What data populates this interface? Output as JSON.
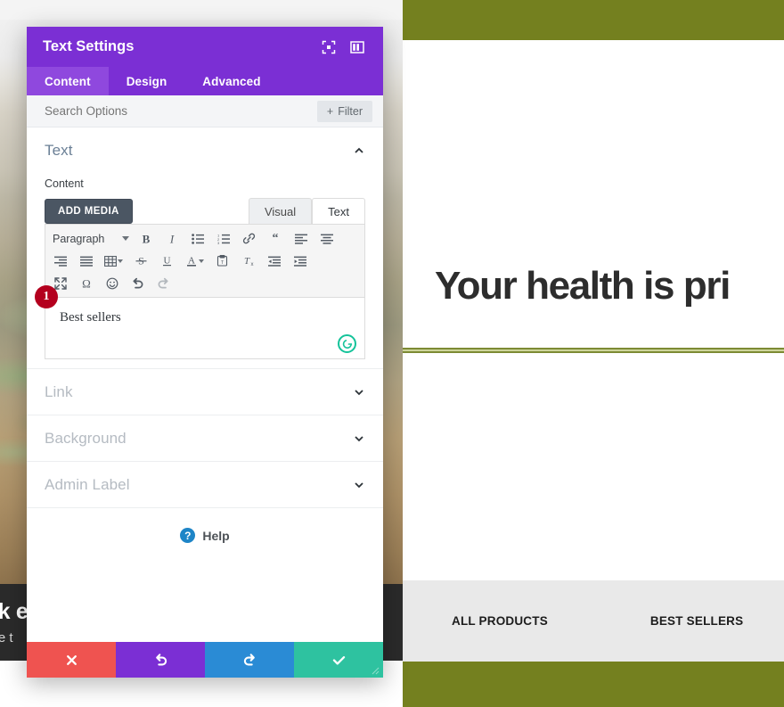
{
  "website": {
    "hero_heading": "Your health is pri",
    "dark_band": {
      "heading": "ck e",
      "subtext": "ove t"
    },
    "nav": [
      {
        "label": "ALL PRODUCTS"
      },
      {
        "label": "BEST SELLERS"
      }
    ],
    "colors": {
      "olive": "#74801f",
      "olive_rule": "#7d8b34",
      "dark": "#2b2b2b",
      "nav_strip": "#e9e9e9"
    }
  },
  "modal": {
    "title": "Text Settings",
    "header_icons": [
      {
        "name": "focus-mode-icon"
      },
      {
        "name": "layout-panel-icon"
      }
    ],
    "tabs": [
      {
        "label": "Content",
        "active": true
      },
      {
        "label": "Design",
        "active": false
      },
      {
        "label": "Advanced",
        "active": false
      }
    ],
    "search": {
      "placeholder": "Search Options",
      "value": ""
    },
    "filter_button": {
      "label": "Filter",
      "plus": "+"
    },
    "sections": [
      {
        "label": "Text",
        "expanded": true
      },
      {
        "label": "Link",
        "expanded": false
      },
      {
        "label": "Background",
        "expanded": false
      },
      {
        "label": "Admin Label",
        "expanded": false
      }
    ],
    "content_field": {
      "label": "Content",
      "add_media_label": "ADD MEDIA",
      "editor_tabs": [
        {
          "label": "Visual",
          "active": false
        },
        {
          "label": "Text",
          "active": true
        }
      ],
      "format_select": "Paragraph",
      "editor_value": "Best sellers",
      "step_badge": "1",
      "grammarly_icon": "grammarly-icon",
      "toolbar_rows": [
        [
          "bold-icon",
          "italic-icon",
          "bulleted-list-icon",
          "numbered-list-icon",
          "link-icon",
          "blockquote-icon",
          "align-left-icon",
          "align-center-icon"
        ],
        [
          "align-right-icon",
          "justify-icon",
          "table-icon",
          "strikethrough-icon",
          "underline-icon",
          "text-color-icon",
          "paste-as-text-icon",
          "clear-formatting-icon",
          "outdent-icon",
          "indent-icon"
        ],
        [
          "fullscreen-icon",
          "special-character-icon",
          "emoji-icon",
          "undo-icon",
          "redo-icon"
        ]
      ]
    },
    "help": {
      "label": "Help",
      "icon": "?"
    },
    "footer_buttons": [
      {
        "name": "cancel-button",
        "glyph": "✖",
        "color": "#ef5350"
      },
      {
        "name": "undo-button",
        "glyph": "↺",
        "color": "#7b2fd4"
      },
      {
        "name": "redo-button",
        "glyph": "↻",
        "color": "#2a8bd5"
      },
      {
        "name": "save-button",
        "glyph": "✔",
        "color": "#2ec2a0"
      }
    ]
  }
}
